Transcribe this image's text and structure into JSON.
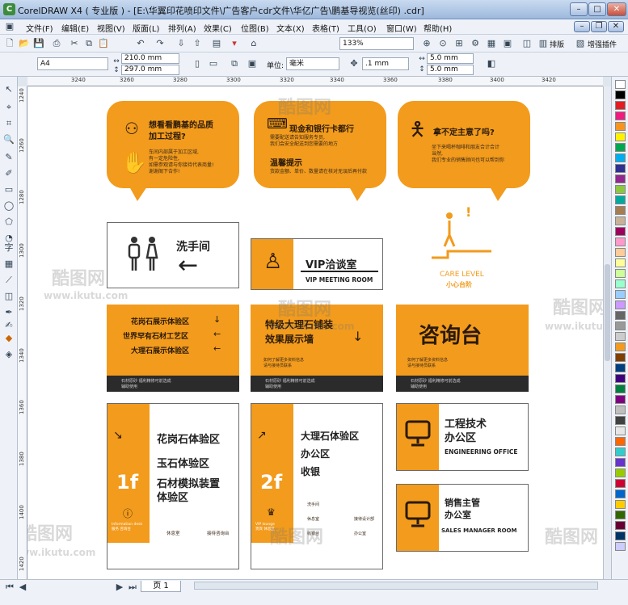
{
  "window": {
    "title": "CorelDRAW X4 ( 专业版 ) - [E:\\华翼印花喷印文件\\广告客户cdr文件\\华亿广告\\鹏基导视览(丝印) .cdr]",
    "logo_letter": "C",
    "minimize": "–",
    "maximize": "□",
    "close": "✕",
    "child_minimize": "–",
    "child_restore": "❐",
    "child_close": "✕"
  },
  "menu": [
    "文件(F)",
    "编辑(E)",
    "视图(V)",
    "版面(L)",
    "排列(A)",
    "效果(C)",
    "位图(B)",
    "文本(X)",
    "表格(T)",
    "工具(O)",
    "窗口(W)",
    "帮助(H)"
  ],
  "toolbar": {
    "zoom": "133%",
    "layout_label": "排版",
    "plugin_label": "增强插件"
  },
  "property_bar": {
    "paper": "A4",
    "width": "210.0 mm",
    "height": "297.0 mm",
    "unit_label": "单位:",
    "unit": "毫米",
    "nudge": ".1 mm",
    "dup_x": "5.0 mm",
    "dup_y": "5.0 mm"
  },
  "rulers": {
    "h_ticks": [
      "3240",
      "3260",
      "3280",
      "3300",
      "3320",
      "3340",
      "3360",
      "3380",
      "3400",
      "3420"
    ],
    "v_ticks": [
      "1260",
      "1280",
      "1300",
      "1320",
      "1340",
      "1360",
      "1380",
      "1400",
      "1420"
    ],
    "v_top": "1240"
  },
  "status": {
    "page_tab": "页 1"
  },
  "watermarks": [
    "酷图网",
    "www.ikutu.com"
  ],
  "palette_colors": [
    "#ffffff",
    "#000000",
    "#e31c23",
    "#ed1c7e",
    "#f7941d",
    "#fff200",
    "#00a651",
    "#00aeef",
    "#2e3192",
    "#92278f",
    "#8dc63f",
    "#00a99d",
    "#a67c52",
    "#c7b299",
    "#9e005d",
    "#ff99cc",
    "#ffcc99",
    "#ffff99",
    "#ccff99",
    "#99ffcc",
    "#99ccff",
    "#cc99ff",
    "#666666",
    "#999999",
    "#cccccc",
    "#f29b1d",
    "#7f3f00",
    "#003f7f",
    "#3f007f",
    "#007f3f",
    "#7f007f",
    "#bfbfbf",
    "#404040",
    "#e6e6e6",
    "#ff6600",
    "#33cccc",
    "#6633cc",
    "#99cc00",
    "#cc0033",
    "#0066cc",
    "#ffcc00",
    "#336600",
    "#660033",
    "#003366",
    "#ccccff"
  ],
  "signs": {
    "bubble1": {
      "title": "想看看鹏基的品质\n加工过程?",
      "body": "车间内部属于加工区域,\n有一定危险性,\n如需参观请与你接待代表商量!\n谢谢阁下合作!"
    },
    "bubble2": {
      "title": "现金和银行卡都行",
      "body1": "需要配送请告知服务专员,\n我们会安全配送到您需要的地方",
      "subtitle": "温馨提示",
      "body2": "货款金额、单价、数量请在核对无误后再付款"
    },
    "bubble3": {
      "title": "拿不定主意了吗?",
      "body": "坐下来喝杯咖啡和朋友合计合计\n当然,\n我们专业的销售顾问也可以帮到你"
    },
    "toilet": {
      "label": "洗手间",
      "arrow": "←"
    },
    "vip": {
      "cn": "VIP洽谈室",
      "en": "VIP MEETING ROOM"
    },
    "care": {
      "mark": "!",
      "en": "CARE LEVEL",
      "cn": "小心台阶"
    },
    "dir1": {
      "rows": [
        {
          "label": "花岗石展示体验区",
          "arrow": "↓"
        },
        {
          "label": "世界罕有石材工艺区",
          "arrow": "←"
        },
        {
          "label": "大理石展示体验区",
          "arrow": "←"
        }
      ],
      "foot1": "石材原砂 福利精修可前选成",
      "foot2": "辅助使用"
    },
    "dir2": {
      "title": "特级大理石铺装\n效果展示墙",
      "arrow": "↓",
      "note": "如何了解更多资料信息\n请与接待员联系",
      "foot1": "石材原砂 福利精修可前选成",
      "foot2": "辅助使用"
    },
    "dir3": {
      "title": "咨询台",
      "note": "如何了解更多资料信息\n请与接待员联系",
      "foot1": "石材原砂 福利精修可前选成",
      "foot2": "辅助使用"
    },
    "floor1": {
      "floor": "1f",
      "items": [
        "花岗石体验区",
        "玉石体验区",
        "石材模拟装置\n体验区"
      ],
      "info": "Information desk\n服务 咨询台",
      "foot": [
        "休息室",
        "接待咨询台"
      ]
    },
    "floor2": {
      "floor": "2f",
      "items": [
        "大理石体验区",
        "办公区",
        "收银"
      ],
      "info": "VIP lounge\n贵宾 休息区",
      "foot": [
        "洗手间",
        "休息室",
        "收银台",
        "接待设计部",
        "办公室"
      ]
    },
    "eng": {
      "cn": "工程技术\n办公区",
      "en": "ENGINEERING OFFICE"
    },
    "sales": {
      "cn": "销售主管\n办公室",
      "en": "SALES MANAGER ROOM"
    }
  }
}
